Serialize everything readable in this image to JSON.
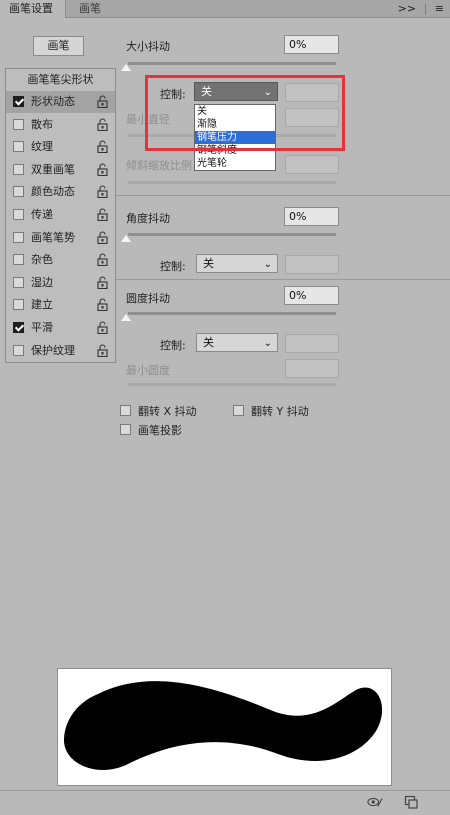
{
  "tabs": [
    {
      "label": "画笔设置",
      "active": true
    },
    {
      "label": "画笔",
      "active": false
    }
  ],
  "menu": {
    "collapse": ">>",
    "menu": "≡"
  },
  "brush_button": "画笔",
  "left_panel": {
    "header": "画笔笔尖形状",
    "items": [
      {
        "label": "形状动态",
        "checked": true
      },
      {
        "label": "散布",
        "checked": false
      },
      {
        "label": "纹理",
        "checked": false
      },
      {
        "label": "双重画笔",
        "checked": false
      },
      {
        "label": "颜色动态",
        "checked": false
      },
      {
        "label": "传递",
        "checked": false
      },
      {
        "label": "画笔笔势",
        "checked": false
      },
      {
        "label": "杂色",
        "checked": false
      },
      {
        "label": "湿边",
        "checked": false
      },
      {
        "label": "建立",
        "checked": false
      },
      {
        "label": "平滑",
        "checked": true
      },
      {
        "label": "保护纹理",
        "checked": false
      }
    ]
  },
  "size_jitter": {
    "label": "大小抖动",
    "value": "0%",
    "control_label": "控制:",
    "control_value": "关",
    "min_diameter_label": "最小直径",
    "tilt_scale_label": "倾斜缩放比例"
  },
  "dropdown_options": [
    "关",
    "渐隐",
    "钢笔压力",
    "钢笔斜度",
    "光笔轮"
  ],
  "dropdown_highlight_index": 2,
  "angle_jitter": {
    "label": "角度抖动",
    "value": "0%",
    "control_label": "控制:",
    "control_value": "关"
  },
  "roundness_jitter": {
    "label": "圆度抖动",
    "value": "0%",
    "control_label": "控制:",
    "control_value": "关",
    "min_roundness_label": "最小圆度"
  },
  "flip_x": {
    "label": "翻转 X 抖动",
    "checked": false
  },
  "flip_y": {
    "label": "翻转 Y 抖动",
    "checked": false
  },
  "brush_projection": {
    "label": "画笔投影",
    "checked": false
  },
  "footer": {
    "icons": [
      "eye-brush-icon",
      "new-preset-icon"
    ]
  }
}
